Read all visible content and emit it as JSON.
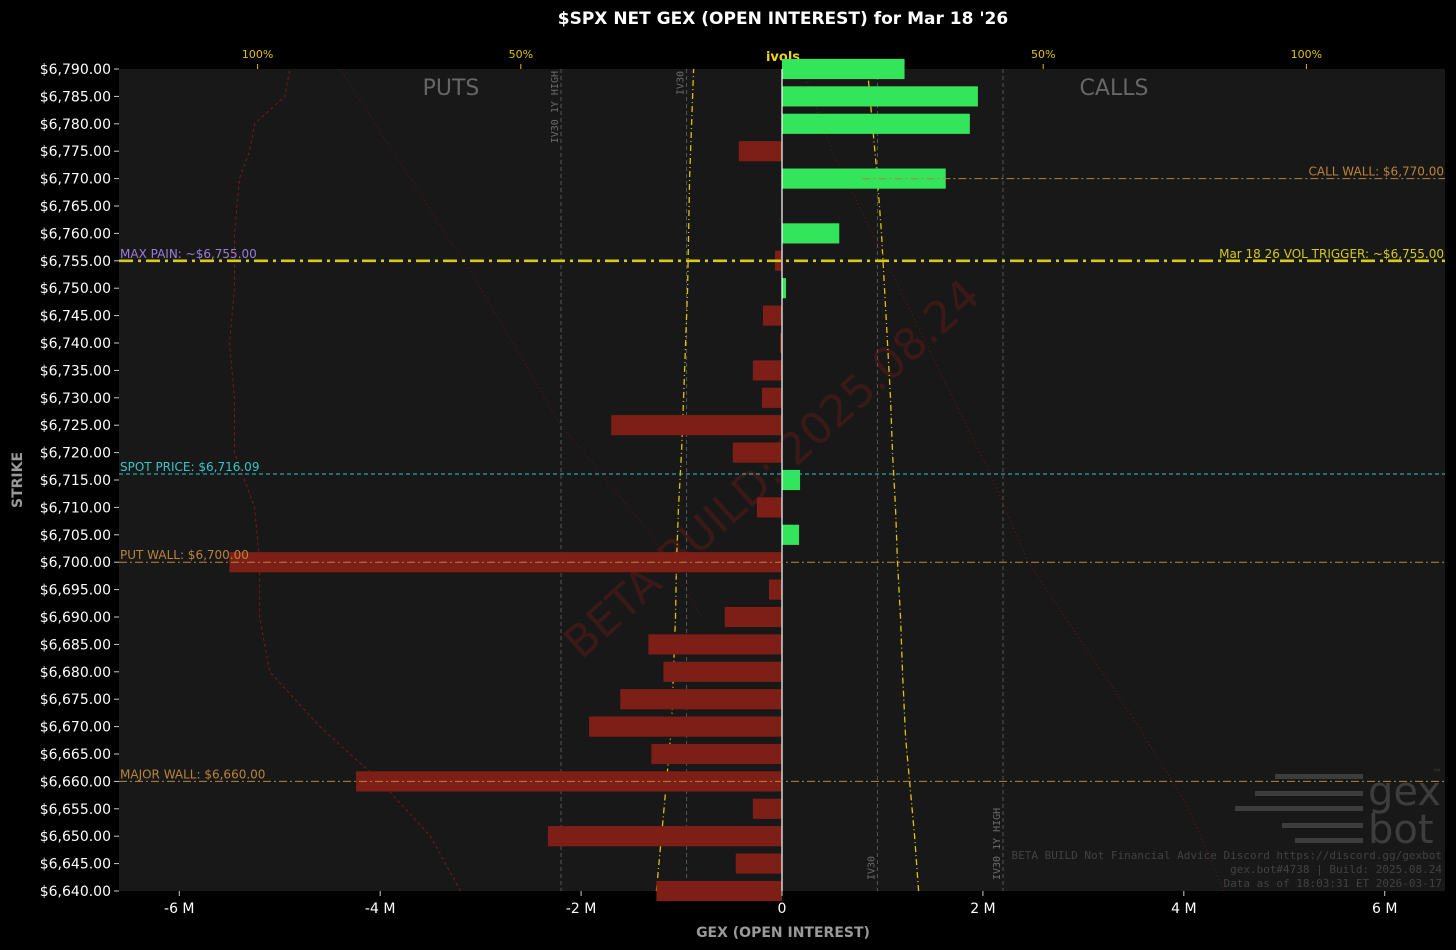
{
  "colors": {
    "background": "#000000",
    "plot_bg": "#181818",
    "positive": "#33e55a",
    "negative": "#7d1f16",
    "vol_trigger": "#d4cc18",
    "spot": "#35c6c8",
    "max_pain": "#9a7ed8",
    "wall": "#b8843a",
    "ivol": "#e2c200"
  },
  "chart_data": {
    "type": "bar",
    "orientation": "horizontal",
    "title": "$SPX NET GEX (OPEN INTEREST) for Mar 18 '26",
    "xlabel": "GEX (OPEN INTEREST)",
    "ylabel": "STRIKE",
    "xlim": [
      -6.6,
      6.6
    ],
    "ylim": [
      6640,
      6790
    ],
    "x_ticks": [
      {
        "v": -6,
        "label": "-6 M"
      },
      {
        "v": -4,
        "label": "-4 M"
      },
      {
        "v": -2,
        "label": "-2 M"
      },
      {
        "v": 0,
        "label": "0"
      },
      {
        "v": 2,
        "label": "2 M"
      },
      {
        "v": 4,
        "label": "4 M"
      },
      {
        "v": 6,
        "label": "6 M"
      }
    ],
    "y_ticks": [
      "$6,790.00",
      "$6,785.00",
      "$6,780.00",
      "$6,775.00",
      "$6,770.00",
      "$6,765.00",
      "$6,760.00",
      "$6,755.00",
      "$6,750.00",
      "$6,745.00",
      "$6,740.00",
      "$6,735.00",
      "$6,730.00",
      "$6,725.00",
      "$6,720.00",
      "$6,715.00",
      "$6,710.00",
      "$6,705.00",
      "$6,700.00",
      "$6,695.00",
      "$6,690.00",
      "$6,685.00",
      "$6,680.00",
      "$6,675.00",
      "$6,670.00",
      "$6,665.00",
      "$6,660.00",
      "$6,655.00",
      "$6,650.00",
      "$6,645.00",
      "$6,640.00"
    ],
    "top_axis": {
      "title": "ivols",
      "ticks": [
        {
          "v": -5.22,
          "label": "100%"
        },
        {
          "v": -2.6,
          "label": "50%"
        },
        {
          "v": 2.6,
          "label": "50%"
        },
        {
          "v": 5.22,
          "label": "100%"
        }
      ]
    },
    "side_labels": {
      "left": "PUTS",
      "right": "CALLS"
    },
    "bars": [
      {
        "strike": 6790,
        "value": 1.22
      },
      {
        "strike": 6785,
        "value": 1.95
      },
      {
        "strike": 6780,
        "value": 1.87
      },
      {
        "strike": 6775,
        "value": -0.43
      },
      {
        "strike": 6770,
        "value": 1.63
      },
      {
        "strike": 6760,
        "value": 0.57
      },
      {
        "strike": 6755,
        "value": -0.07
      },
      {
        "strike": 6750,
        "value": 0.04
      },
      {
        "strike": 6745,
        "value": -0.19
      },
      {
        "strike": 6740,
        "value": -0.02
      },
      {
        "strike": 6735,
        "value": -0.29
      },
      {
        "strike": 6730,
        "value": -0.2
      },
      {
        "strike": 6725,
        "value": -1.7
      },
      {
        "strike": 6720,
        "value": -0.49
      },
      {
        "strike": 6715,
        "value": 0.18
      },
      {
        "strike": 6710,
        "value": -0.25
      },
      {
        "strike": 6705,
        "value": 0.17
      },
      {
        "strike": 6700,
        "value": -5.5
      },
      {
        "strike": 6695,
        "value": -0.13
      },
      {
        "strike": 6690,
        "value": -0.57
      },
      {
        "strike": 6685,
        "value": -1.33
      },
      {
        "strike": 6680,
        "value": -1.18
      },
      {
        "strike": 6675,
        "value": -1.61
      },
      {
        "strike": 6670,
        "value": -1.92
      },
      {
        "strike": 6665,
        "value": -1.3
      },
      {
        "strike": 6660,
        "value": -4.24
      },
      {
        "strike": 6655,
        "value": -0.29
      },
      {
        "strike": 6650,
        "value": -2.33
      },
      {
        "strike": 6645,
        "value": -0.46
      },
      {
        "strike": 6640,
        "value": -1.25
      }
    ],
    "levels": [
      {
        "name": "max-pain",
        "strike": 6755,
        "label": "MAX PAIN: ~$6,755.00",
        "side": "left",
        "style": "none",
        "color_key": "max_pain"
      },
      {
        "name": "vol-trigger",
        "strike": 6755,
        "label": "Mar 18 26 VOL TRIGGER: ~$6,755.00",
        "side": "right",
        "style": "dashdot-thick",
        "color_key": "vol_trigger"
      },
      {
        "name": "call-wall",
        "strike": 6770,
        "label": "CALL WALL: $6,770.00",
        "side": "right",
        "style": "dashdot-partial",
        "color_key": "wall"
      },
      {
        "name": "spot-price",
        "strike": 6716.09,
        "label": "SPOT PRICE: $6,716.09",
        "side": "left",
        "style": "dashed",
        "color_key": "spot"
      },
      {
        "name": "put-wall",
        "strike": 6700,
        "label": "PUT WALL: $6,700.00",
        "side": "left",
        "style": "dashdot",
        "color_key": "wall"
      },
      {
        "name": "major-wall",
        "strike": 6660,
        "label": "MAJOR WALL: $6,660.00",
        "side": "left",
        "style": "dashdot",
        "color_key": "wall"
      }
    ],
    "vertical_markers": [
      {
        "x": -2.2,
        "label": "IV30 1Y HIGH",
        "label_strike": 6790,
        "anchor": "top"
      },
      {
        "x": 2.2,
        "label": "IV30 1Y HIGH",
        "label_strike": 6642,
        "anchor": "bottom"
      },
      {
        "x": -0.95,
        "label": "IV30",
        "label_strike": 6790,
        "anchor": "top"
      },
      {
        "x": 0.95,
        "label": "IV30",
        "label_strike": 6642,
        "anchor": "bottom"
      }
    ],
    "ivol_curves": {
      "put": [
        [
          -1.25,
          6640
        ],
        [
          -1.2,
          6650
        ],
        [
          -1.15,
          6660
        ],
        [
          -1.1,
          6670
        ],
        [
          -1.08,
          6680
        ],
        [
          -1.06,
          6690
        ],
        [
          -1.05,
          6700
        ],
        [
          -1.03,
          6710
        ],
        [
          -1.0,
          6720
        ],
        [
          -0.98,
          6730
        ],
        [
          -0.96,
          6740
        ],
        [
          -0.94,
          6750
        ],
        [
          -0.93,
          6760
        ],
        [
          -0.92,
          6770
        ],
        [
          -0.9,
          6780
        ],
        [
          -0.88,
          6790
        ]
      ],
      "call": [
        [
          1.36,
          6640
        ],
        [
          1.32,
          6650
        ],
        [
          1.27,
          6660
        ],
        [
          1.23,
          6668
        ],
        [
          1.2,
          6680
        ],
        [
          1.18,
          6690
        ],
        [
          1.15,
          6700
        ],
        [
          1.13,
          6710
        ],
        [
          1.1,
          6720
        ],
        [
          1.08,
          6730
        ],
        [
          1.05,
          6740
        ],
        [
          1.02,
          6750
        ],
        [
          0.99,
          6760
        ],
        [
          0.95,
          6770
        ],
        [
          0.9,
          6780
        ],
        [
          0.85,
          6790
        ]
      ],
      "put_wide": [
        [
          -3.2,
          6640
        ],
        [
          -3.5,
          6650
        ],
        [
          -4.0,
          6660
        ],
        [
          -4.6,
          6670
        ],
        [
          -5.1,
          6680
        ],
        [
          -5.2,
          6690
        ],
        [
          -5.2,
          6700
        ],
        [
          -5.25,
          6710
        ],
        [
          -5.45,
          6720
        ],
        [
          -5.45,
          6730
        ],
        [
          -5.5,
          6740
        ],
        [
          -5.45,
          6750
        ],
        [
          -5.45,
          6760
        ],
        [
          -5.4,
          6770
        ],
        [
          -5.3,
          6775
        ],
        [
          -5.25,
          6780
        ],
        [
          -4.95,
          6785
        ],
        [
          -4.9,
          6790
        ]
      ],
      "call_wide": [
        [
          4.4,
          6640
        ],
        [
          4.05,
          6655
        ],
        [
          3.55,
          6670
        ],
        [
          3.0,
          6685
        ],
        [
          2.45,
          6700
        ],
        [
          2.1,
          6715
        ],
        [
          1.7,
          6730
        ],
        [
          1.3,
          6745
        ],
        [
          0.9,
          6760
        ],
        [
          0.5,
          6775
        ],
        [
          0.2,
          6790
        ]
      ],
      "put_wide_diag": [
        [
          -4.4,
          6790
        ],
        [
          -3.7,
          6770
        ],
        [
          -3.0,
          6750
        ],
        [
          -2.2,
          6725
        ],
        [
          -1.3,
          6705
        ],
        [
          -0.8,
          6690
        ]
      ]
    },
    "watermark": "BETA BUILD: 2025.08.24",
    "footer": [
      "BETA BUILD Not Financial Advice Discord https://discord.gg/gexbot",
      "gex.bot#4738 | Build: 2025.08.24",
      "Data as of 18:03:31 ET 2026-03-17"
    ],
    "logo": {
      "line1": "gex",
      "line2": "bot",
      "mark": "™"
    }
  }
}
